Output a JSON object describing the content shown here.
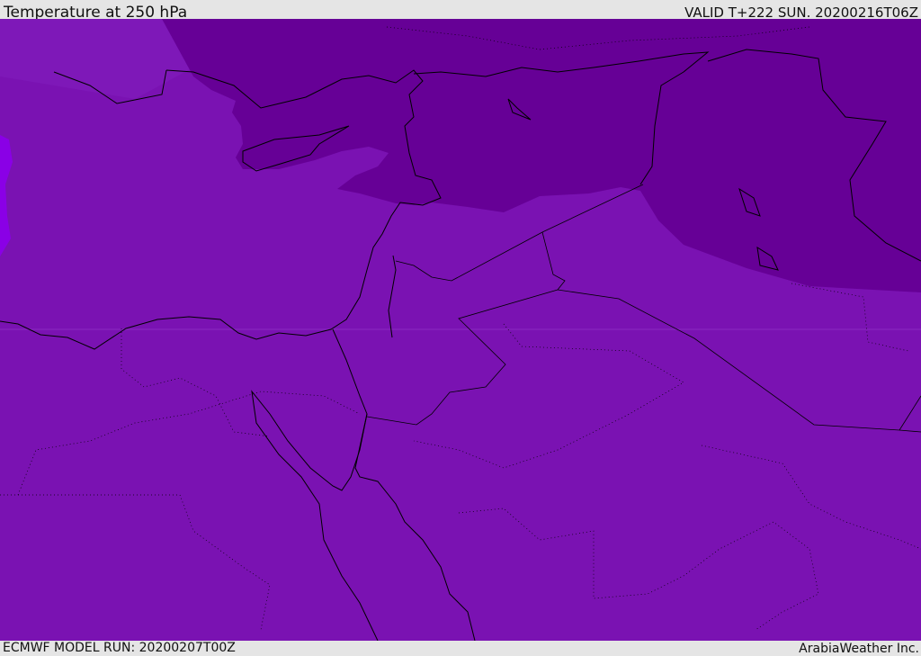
{
  "header": {
    "title": "Temperature at 250 hPa",
    "valid": "VALID T+222 SUN. 20200216T06Z"
  },
  "footer": {
    "model_run": "ECMWF MODEL RUN: 20200207T00Z",
    "credit": "ArabiaWeather Inc."
  },
  "colors": {
    "base": "#7a12b2",
    "cold": "#660096",
    "light": "#7e18b8",
    "warm_edge": "#8a00e6",
    "coast": "#000000"
  }
}
